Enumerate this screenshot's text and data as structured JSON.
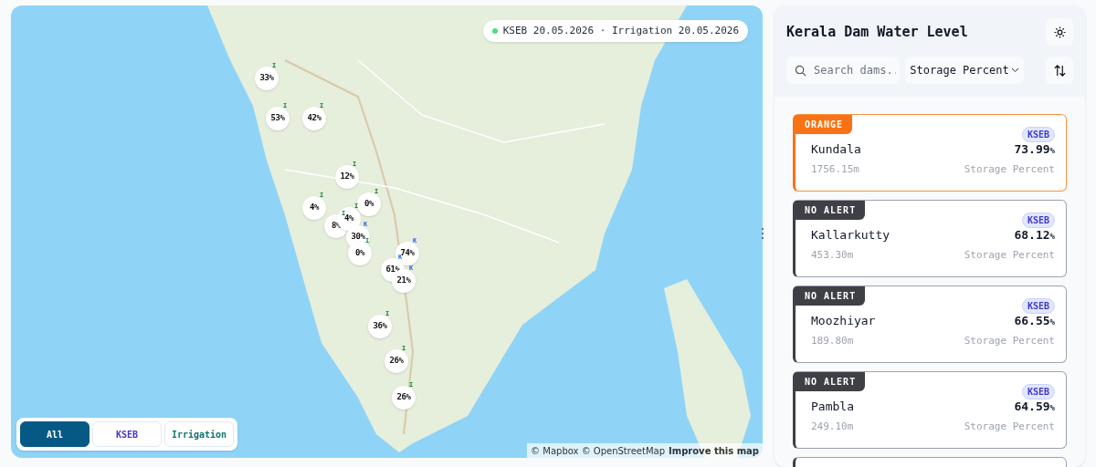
{
  "map": {
    "update_badge": "KSEB 20.05.2026 · Irrigation 20.05.2026",
    "markers": [
      {
        "label": "33%",
        "tag": "I"
      },
      {
        "label": "53%",
        "tag": "I"
      },
      {
        "label": "42%",
        "tag": "I"
      },
      {
        "label": "12%",
        "tag": "I"
      },
      {
        "label": "4%",
        "tag": "I"
      },
      {
        "label": "0%",
        "tag": "I"
      },
      {
        "label": "8%",
        "tag": "I"
      },
      {
        "label": "4%",
        "tag": "I"
      },
      {
        "label": "30%",
        "tag": "K"
      },
      {
        "label": "0%",
        "tag": "I"
      },
      {
        "label": "74%",
        "tag": "K"
      },
      {
        "label": "61%",
        "tag": "K"
      },
      {
        "label": "21%",
        "tag": "K"
      },
      {
        "label": "36%",
        "tag": "I"
      },
      {
        "label": "26%",
        "tag": "I"
      },
      {
        "label": "26%",
        "tag": "I"
      }
    ],
    "filters": [
      {
        "label": "All",
        "selected": true,
        "color": "#075985"
      },
      {
        "label": "KSEB",
        "selected": false,
        "color": "#4338ca"
      },
      {
        "label": "Irrigation",
        "selected": false,
        "color": "#0f766e"
      }
    ],
    "attribution": {
      "text": "© Mapbox © OpenStreetMap",
      "link": "Improve this map"
    }
  },
  "sidebar": {
    "title": "Kerala Dam Water Level",
    "search": {
      "placeholder": "Search dams.."
    },
    "sort": {
      "value": "Storage Percent"
    },
    "dams": [
      {
        "alert": "ORANGE",
        "kind": "orange",
        "source": "KSEB",
        "name": "Kundala",
        "level_m": "1756.15m",
        "value": "73.99",
        "unit": "%",
        "metric": "Storage Percent"
      },
      {
        "alert": "NO ALERT",
        "kind": "none",
        "source": "KSEB",
        "name": "Kallarkutty",
        "level_m": "453.30m",
        "value": "68.12",
        "unit": "%",
        "metric": "Storage Percent"
      },
      {
        "alert": "NO ALERT",
        "kind": "none",
        "source": "KSEB",
        "name": "Moozhiyar",
        "level_m": "189.80m",
        "value": "66.55",
        "unit": "%",
        "metric": "Storage Percent"
      },
      {
        "alert": "NO ALERT",
        "kind": "none",
        "source": "KSEB",
        "name": "Pambla",
        "level_m": "249.10m",
        "value": "64.59",
        "unit": "%",
        "metric": "Storage Percent"
      }
    ]
  }
}
